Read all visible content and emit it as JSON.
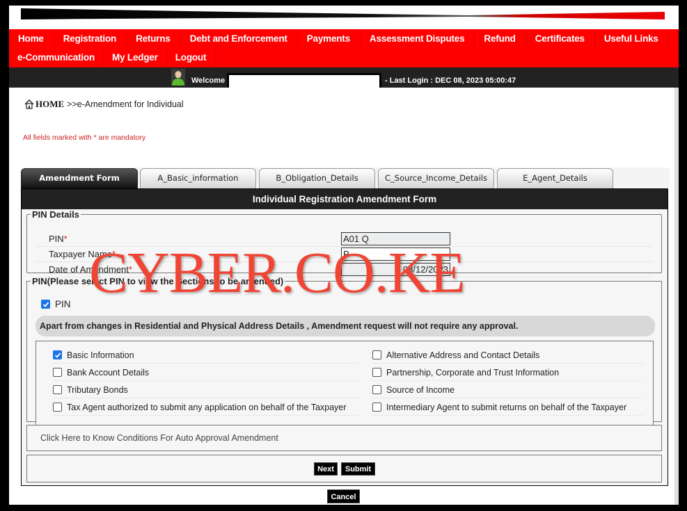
{
  "menu": {
    "row1": [
      "Home",
      "Registration",
      "Returns",
      "Debt and Enforcement",
      "Payments",
      "Assessment Disputes",
      "Refund",
      "Certificates",
      "Useful Links"
    ],
    "row2": [
      "e-Communication",
      "My Ledger",
      "Logout"
    ]
  },
  "welcome": {
    "label": "Welcome",
    "name": "",
    "last_login": "- Last Login : DEC 08, 2023 05:00:47"
  },
  "breadcrumb": {
    "home": "HOME",
    "current": ">>e-Amendment for Individual"
  },
  "mandatory_note": "All fields marked with * are mandatory",
  "tabs": [
    {
      "label": "Amendment Form",
      "active": true
    },
    {
      "label": "A_Basic_information",
      "active": false
    },
    {
      "label": "B_Obligation_Details",
      "active": false
    },
    {
      "label": "C_Source_Income_Details",
      "active": false
    },
    {
      "label": "E_Agent_Details",
      "active": false
    }
  ],
  "form": {
    "title": "Individual Registration Amendment Form",
    "pin_details": {
      "legend": "PIN Details",
      "fields": [
        {
          "label": "PIN",
          "required": true,
          "value": "A01            Q"
        },
        {
          "label": "Taxpayer Name",
          "required": true,
          "value": "P"
        },
        {
          "label": "Date of Amendment",
          "required": true,
          "value": "08/12/2023"
        }
      ]
    },
    "pin_select": {
      "legend": "PIN(Please select PIN to view the Sections to be amended)",
      "pin_checkbox": {
        "label": "PIN",
        "checked": true
      },
      "note": "Apart from changes in Residential and Physical Address Details , Amendment request will not require any approval.",
      "options_left": [
        {
          "label": "Basic Information",
          "checked": true
        },
        {
          "label": "Bank Account Details",
          "checked": false
        },
        {
          "label": "Tributary Bonds",
          "checked": false
        },
        {
          "label": "Tax Agent authorized to submit any application on behalf of the Taxpayer",
          "checked": false
        }
      ],
      "options_right": [
        {
          "label": "Alternative Address and Contact Details",
          "checked": false
        },
        {
          "label": "Partnership, Corporate and Trust Information",
          "checked": false
        },
        {
          "label": "Source of Income",
          "checked": false
        },
        {
          "label": "Intermediary Agent to submit returns on behalf of the Taxpayer",
          "checked": false
        }
      ]
    },
    "auto_approval_link": "Click Here to Know Conditions For Auto Approval Amendment",
    "buttons": {
      "next": "Next",
      "submit": "Submit"
    }
  },
  "cancel_button": "Cancel",
  "watermark": "CYBER.CO.KE",
  "colors": {
    "menu_red": "#ff0000",
    "dark_bar": "#222222",
    "mandatory_red": "#d02020",
    "watermark_red": "#f04535",
    "checkbox_blue": "#1a73e8"
  }
}
